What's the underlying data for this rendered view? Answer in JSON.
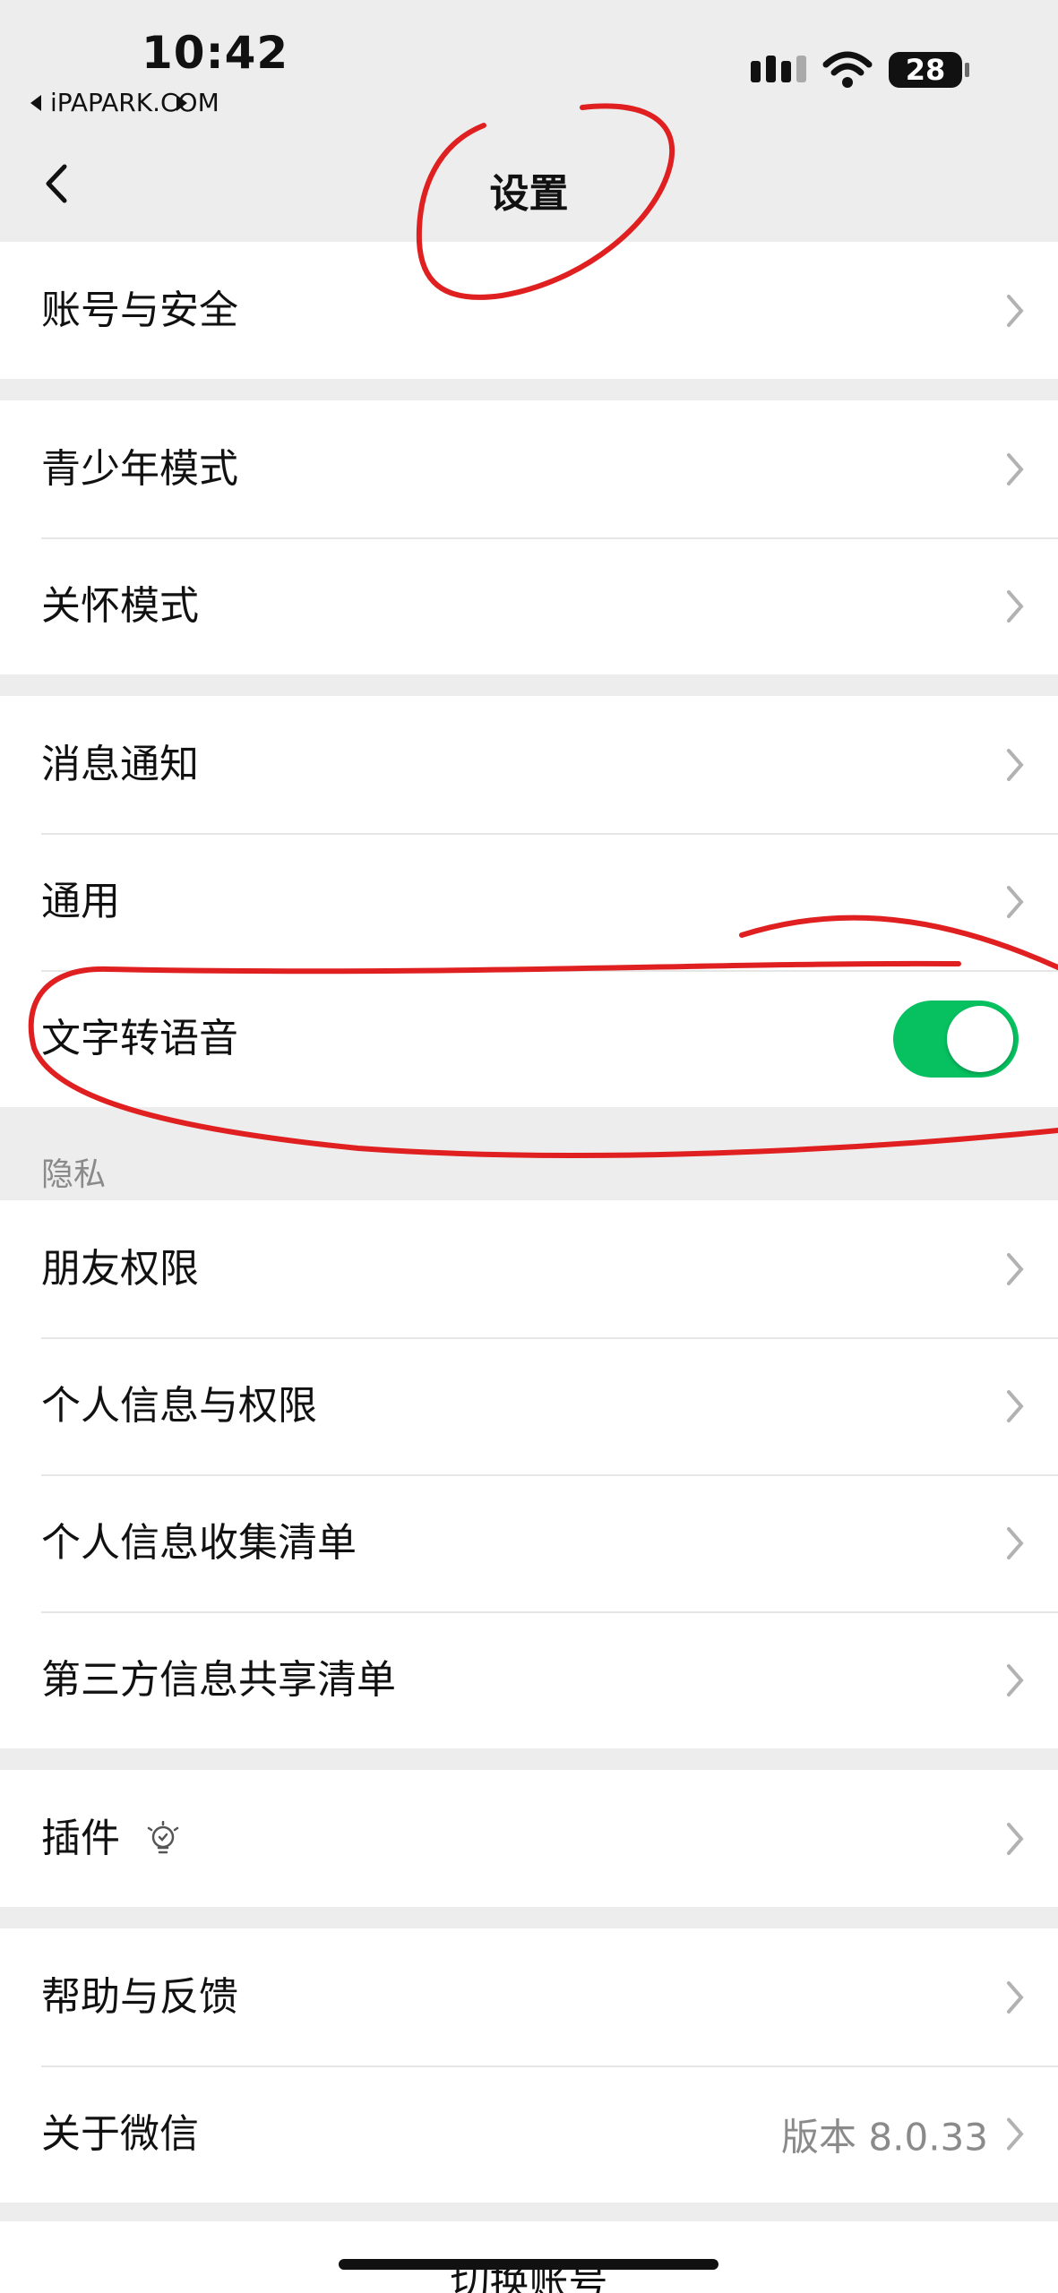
{
  "status": {
    "time": "10:42",
    "back_app": "iPAPARK.COM",
    "battery": "28"
  },
  "nav": {
    "title": "设置"
  },
  "groups": {
    "account": [
      {
        "label": "账号与安全"
      }
    ],
    "modes": [
      {
        "label": "青少年模式"
      },
      {
        "label": "关怀模式"
      }
    ],
    "general": [
      {
        "label": "消息通知"
      },
      {
        "label": "通用"
      },
      {
        "label": "文字转语音",
        "toggle": true
      }
    ],
    "privacy_header": "隐私",
    "privacy": [
      {
        "label": "朋友权限"
      },
      {
        "label": "个人信息与权限"
      },
      {
        "label": "个人信息收集清单"
      },
      {
        "label": "第三方信息共享清单"
      }
    ],
    "plugins": [
      {
        "label": "插件"
      }
    ],
    "help": [
      {
        "label": "帮助与反馈"
      },
      {
        "label": "关于微信",
        "value": "版本 8.0.33"
      }
    ]
  },
  "bottom": {
    "label": "切换账号"
  },
  "icons": {
    "back": "chevron-left-icon",
    "chevron": "chevron-right-icon",
    "plugin": "lightbulb-icon",
    "wifi": "wifi-icon",
    "signal": "cellular-signal-icon",
    "battery": "battery-icon"
  },
  "colors": {
    "toggle_on": "#07c160",
    "annotation": "#e02020"
  }
}
